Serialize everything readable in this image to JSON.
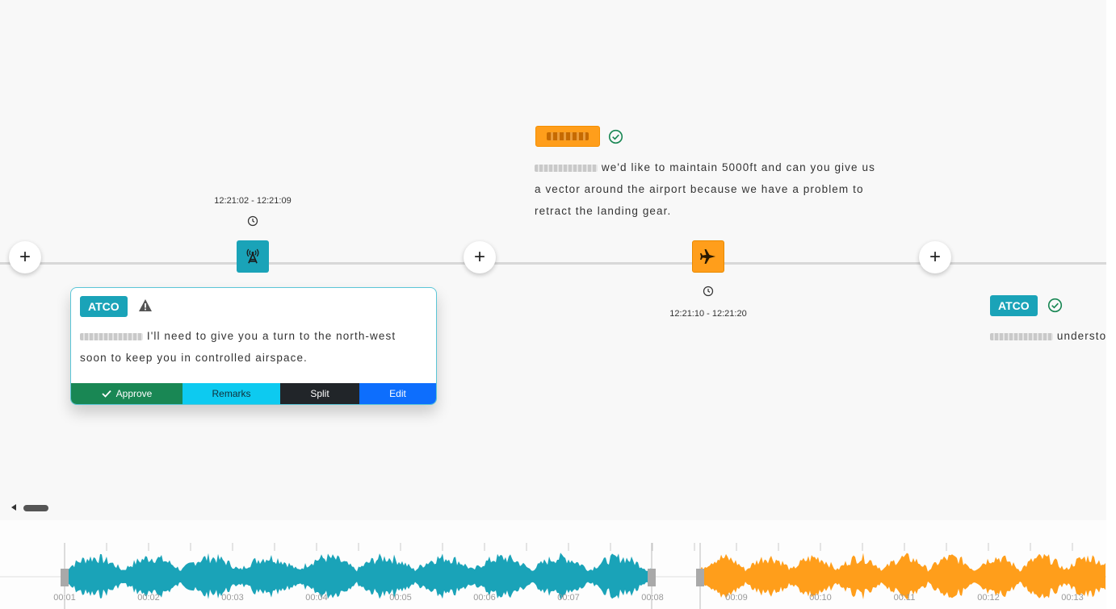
{
  "colors": {
    "atco": "#1aa3b8",
    "pilot": "#ff9e1b",
    "approve": "#198754",
    "remarks": "#0dcaf0",
    "split": "#212529",
    "edit": "#0d6efd",
    "check": "#198754",
    "warning": "#555555"
  },
  "timeline": {
    "segments": [
      {
        "speaker": "ATCO",
        "icon": "antenna-icon",
        "time_range": "12:21:02 - 12:21:09",
        "status_icon": "warning-icon",
        "text_line1": "I'll need to give you a turn to the north-west",
        "text_line2": "soon to keep you in controlled airspace."
      },
      {
        "speaker": "",
        "icon": "airplane-icon",
        "time_range": "12:21:10 - 12:21:20",
        "status_icon": "check-circle-icon",
        "text_line1": "we'd like to maintain 5000ft and can you give us",
        "text_line2": "a vector around the airport because we have a problem to",
        "text_line3": "retract the landing gear."
      },
      {
        "speaker": "ATCO",
        "status_icon": "check-circle-icon",
        "text_line1": "understo"
      }
    ]
  },
  "card_actions": {
    "approve": "Approve",
    "remarks": "Remarks",
    "split": "Split",
    "edit": "Edit"
  },
  "waveform": {
    "tick_labels": [
      "00:01",
      "00:02",
      "00:03",
      "00:04",
      "00:05",
      "00:06",
      "00:07",
      "00:08",
      "00:09",
      "00:10",
      "00:11",
      "00:12",
      "00:13"
    ]
  }
}
